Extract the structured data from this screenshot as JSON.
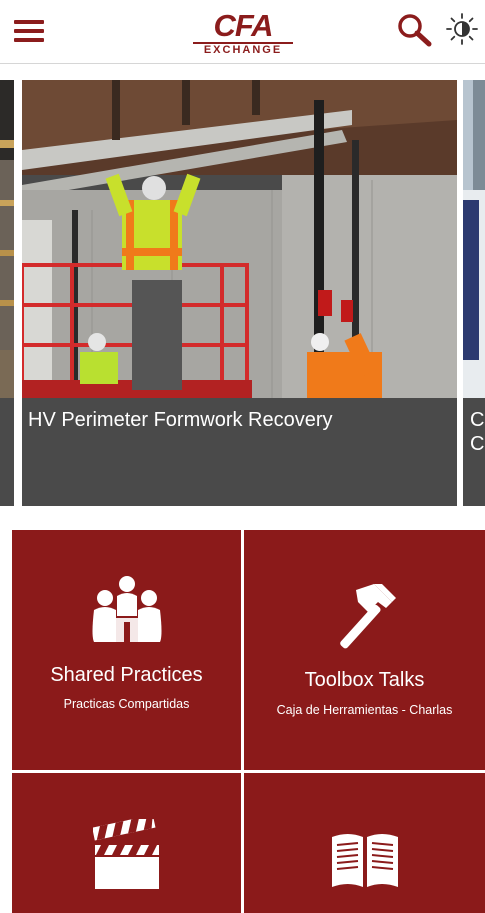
{
  "header": {
    "logo_main": "CFA",
    "logo_sub": "EXCHANGE",
    "menu_icon": "hamburger-menu-icon",
    "search_icon": "search-icon",
    "brightness_icon": "brightness-icon"
  },
  "carousel": {
    "slides": [
      {
        "title": ""
      },
      {
        "title": "HV Perimeter Formwork Recovery"
      },
      {
        "title": "C C"
      }
    ]
  },
  "tiles": [
    {
      "title": "Shared Practices",
      "subtitle": "Practicas Compartidas",
      "icon": "people-group-icon"
    },
    {
      "title": "Toolbox Talks",
      "subtitle": "Caja de Herramientas - Charlas",
      "icon": "hammer-icon"
    },
    {
      "title": "",
      "subtitle": "",
      "icon": "clapperboard-icon"
    },
    {
      "title": "",
      "subtitle": "",
      "icon": "open-book-icon"
    }
  ],
  "colors": {
    "brand": "#8b1c1c",
    "tile_bg": "#8b1a1a",
    "caption_bg": "#4a4a4a"
  }
}
